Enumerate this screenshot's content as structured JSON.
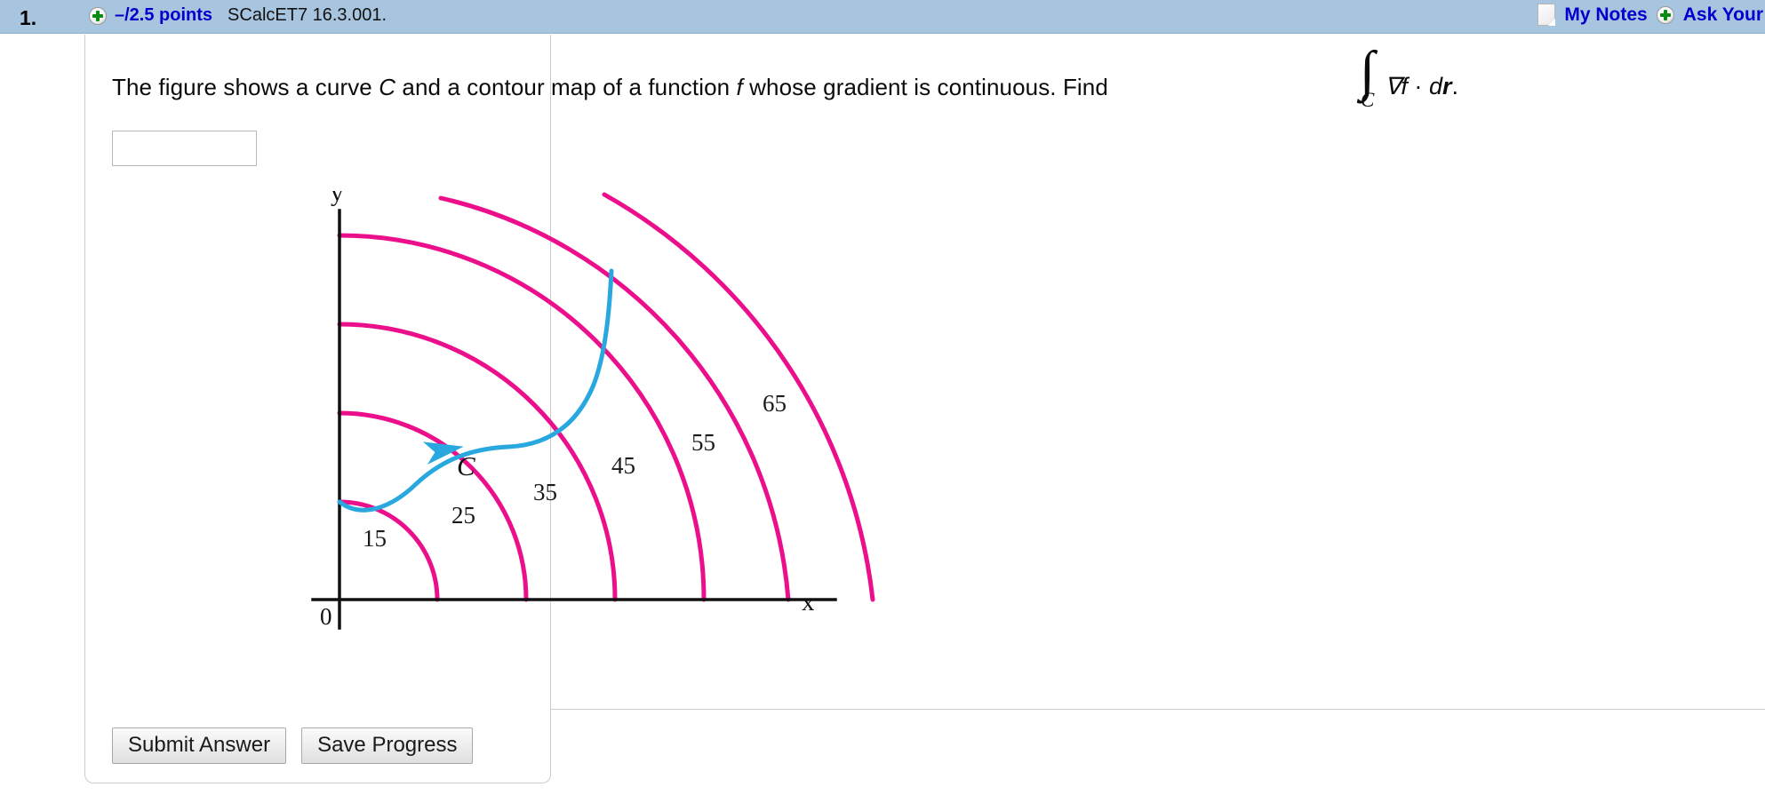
{
  "header": {
    "question_number": "1.",
    "expand_icon": "plus-circle-icon",
    "points": "–/2.5 points",
    "question_code": "SCalcET7 16.3.001.",
    "notes_icon": "document-icon",
    "my_notes_label": "My Notes",
    "ask_icon": "plus-circle-icon",
    "ask_teacher_label": "Ask Your",
    "bar_color": "#a7c5df",
    "link_color": "#0000cc"
  },
  "question": {
    "text_part1": "The figure shows a curve ",
    "var_c": "C",
    "text_part2": " and a contour map of a function ",
    "var_f": "f",
    "text_part3": " whose gradient is continuous. Find",
    "integral_sign": "∫",
    "integral_subscript": "C",
    "integrand": "∇f · dr.",
    "integrand_nabla_f": "∇f",
    "integrand_dot": "·",
    "integrand_d": "d",
    "integrand_r": "r",
    "integrand_period": "."
  },
  "answer": {
    "value": "",
    "placeholder": ""
  },
  "figure": {
    "y_axis_label": "y",
    "x_axis_label": "x",
    "origin_label": "0",
    "curve_label": "C",
    "curve_color": "#29a8e0",
    "contour_color": "#ec0f8c",
    "axis_color": "#111111"
  },
  "chart_data": {
    "type": "line",
    "title": "",
    "xlabel": "x",
    "ylabel": "y",
    "annotations": [
      "C",
      "0"
    ],
    "contour_labels": [
      "15",
      "25",
      "35",
      "45",
      "55",
      "65"
    ],
    "contour_values": [
      15,
      25,
      35,
      45,
      55,
      65
    ],
    "contour_radii": [
      110,
      210,
      310,
      410,
      505,
      600
    ],
    "curve": {
      "name": "C",
      "start_value": 15,
      "end_value": 55,
      "direction": "counterclockwise-outward",
      "arrow": true
    },
    "grid": false,
    "legend": "none"
  },
  "buttons": {
    "submit_label": "Submit Answer",
    "save_label": "Save Progress"
  }
}
